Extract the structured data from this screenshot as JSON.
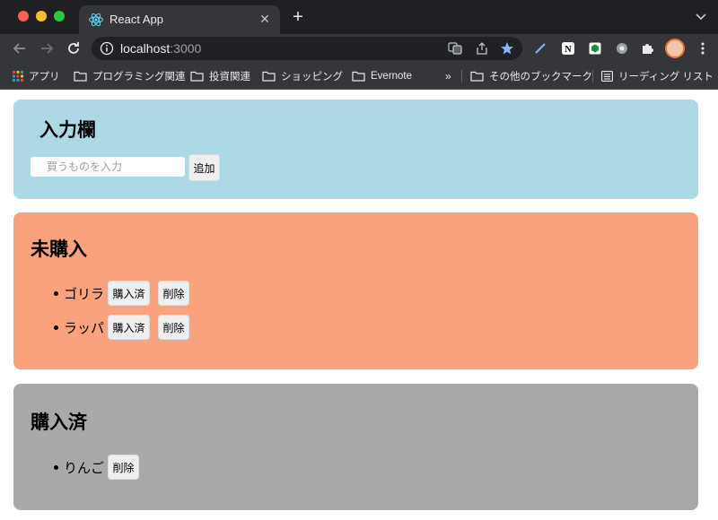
{
  "browser": {
    "tab_title": "React App",
    "url_host": "localhost",
    "url_port": ":3000",
    "bookmarks": {
      "apps": "アプリ",
      "programming": "プログラミング関連",
      "investment": "投資関連",
      "shopping": "ショッピング",
      "evernote": "Evernote",
      "overflow": "»",
      "other": "その他のブックマーク",
      "reading_list": "リーディング リスト"
    }
  },
  "input_area": {
    "title": "入力欄",
    "placeholder": "買うものを入力",
    "add_label": "追加"
  },
  "incomplete": {
    "title": "未購入",
    "items": [
      {
        "text": "ゴリラ",
        "complete_label": "購入済",
        "delete_label": "削除"
      },
      {
        "text": "ラッパ",
        "complete_label": "購入済",
        "delete_label": "削除"
      }
    ]
  },
  "complete": {
    "title": "購入済",
    "items": [
      {
        "text": "りんご",
        "delete_label": "削除"
      }
    ]
  },
  "colors": {
    "input_bg": "#add8e6",
    "incomplete_bg": "#f9a27d",
    "complete_bg": "#a9a9a9"
  }
}
